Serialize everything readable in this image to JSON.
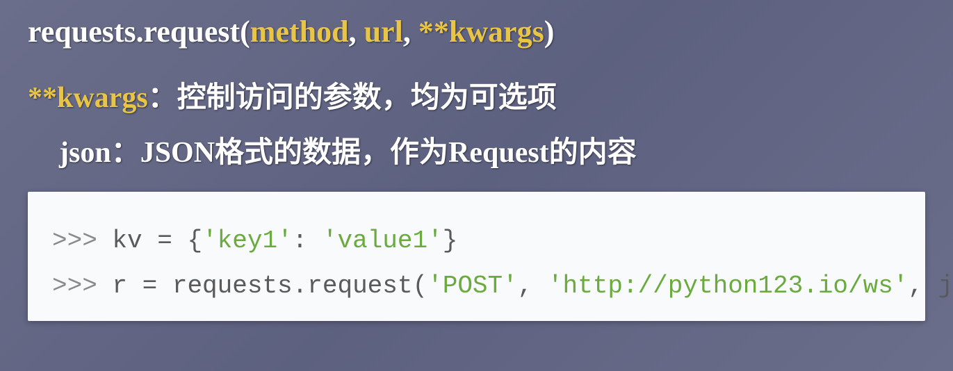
{
  "signature": {
    "prefix": "requests.request(",
    "arg1": "method",
    "sep1": ", ",
    "arg2": "url",
    "sep2": ", ",
    "arg3": "**kwargs",
    "suffix": ")"
  },
  "desc1": {
    "keyword": "**kwargs",
    "colon": "：",
    "text": "控制访问的参数，均为可选项"
  },
  "desc2": {
    "label": "json：",
    "text": "JSON格式的数据，作为Request的内容"
  },
  "code": {
    "line1": {
      "prompt": ">>> ",
      "p1": "kv = {",
      "s1": "'key1'",
      "p2": ": ",
      "s2": "'value1'",
      "p3": "}"
    },
    "line2": {
      "prompt": ">>> ",
      "p1": "r = requests.request(",
      "s1": "'POST'",
      "p2": ", ",
      "s2": "'http://python123.io/ws'",
      "p3": ", json=kv)"
    }
  }
}
